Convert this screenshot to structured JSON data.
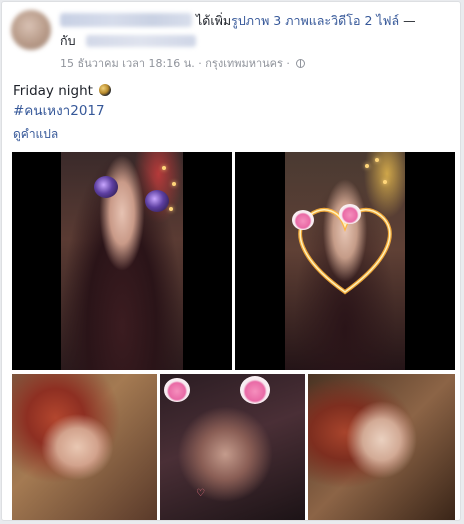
{
  "post": {
    "author_name": "",
    "action_text": "ได้เพิ่ม",
    "action_highlight": "รูปภาพ 3 ภาพและวิดีโอ 2 ไฟล์",
    "action_suffix": " —",
    "with_label": "กับ",
    "timestamp": "15 ธันวาคม เวลา 18:16 น.",
    "separator": " · ",
    "location": "กรุงเทพมหานคร",
    "separator2": " · ",
    "caption": "Friday night",
    "hashtag": "#คนเหงา2017",
    "translate_link": "ดูคำแปล",
    "privacy_icon": "globe-icon",
    "caption_emoji": "moon-emoji"
  },
  "media": [
    {
      "kind": "video",
      "filter": "bear-ears-filter"
    },
    {
      "kind": "video",
      "filter": "heart-glow-filter"
    },
    {
      "kind": "photo"
    },
    {
      "kind": "photo",
      "filter": "pink-ears-filter"
    },
    {
      "kind": "photo"
    }
  ],
  "colors": {
    "link": "#365899",
    "text": "#1d2129",
    "meta": "#90949c",
    "page_bg": "#e9ebee"
  }
}
